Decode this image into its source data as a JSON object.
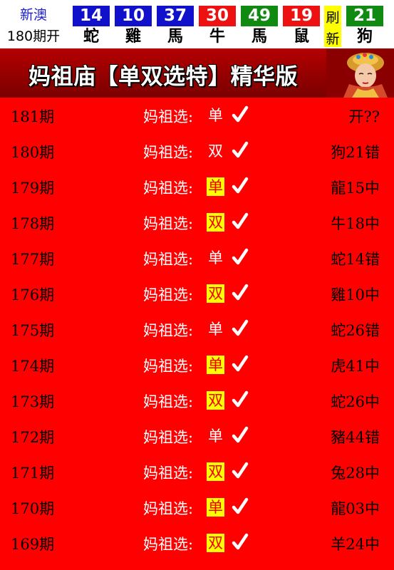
{
  "header": {
    "line1": "新澳",
    "line2": "180期开",
    "balls": [
      {
        "number": "14",
        "zodiac": "蛇",
        "color": "blue"
      },
      {
        "number": "10",
        "zodiac": "雞",
        "color": "blue"
      },
      {
        "number": "37",
        "zodiac": "馬",
        "color": "blue"
      },
      {
        "number": "30",
        "zodiac": "牛",
        "color": "red"
      },
      {
        "number": "49",
        "zodiac": "馬",
        "color": "green"
      },
      {
        "number": "19",
        "zodiac": "鼠",
        "color": "red"
      },
      {
        "number": "21",
        "zodiac": "狗",
        "color": "green"
      }
    ],
    "refresh": {
      "top": "刷",
      "bottom": "新"
    }
  },
  "banner": {
    "title": "妈祖庙【单双选特】精华版"
  },
  "rows": [
    {
      "period": "181期",
      "label": "妈祖选:",
      "pick": "单",
      "highlight": false,
      "result": "开??"
    },
    {
      "period": "180期",
      "label": "妈祖选:",
      "pick": "双",
      "highlight": false,
      "result": "狗21错"
    },
    {
      "period": "179期",
      "label": "妈祖选:",
      "pick": "单",
      "highlight": true,
      "result": "龍15中"
    },
    {
      "period": "178期",
      "label": "妈祖选:",
      "pick": "双",
      "highlight": true,
      "result": "牛18中"
    },
    {
      "period": "177期",
      "label": "妈祖选:",
      "pick": "单",
      "highlight": false,
      "result": "蛇14错"
    },
    {
      "period": "176期",
      "label": "妈祖选:",
      "pick": "双",
      "highlight": true,
      "result": "雞10中"
    },
    {
      "period": "175期",
      "label": "妈祖选:",
      "pick": "单",
      "highlight": false,
      "result": "蛇26错"
    },
    {
      "period": "174期",
      "label": "妈祖选:",
      "pick": "单",
      "highlight": true,
      "result": "虎41中"
    },
    {
      "period": "173期",
      "label": "妈祖选:",
      "pick": "双",
      "highlight": true,
      "result": "蛇26中"
    },
    {
      "period": "172期",
      "label": "妈祖选:",
      "pick": "单",
      "highlight": false,
      "result": "豬44错"
    },
    {
      "period": "171期",
      "label": "妈祖选:",
      "pick": "双",
      "highlight": true,
      "result": "兔28中"
    },
    {
      "period": "170期",
      "label": "妈祖选:",
      "pick": "单",
      "highlight": true,
      "result": "龍03中"
    },
    {
      "period": "169期",
      "label": "妈祖选:",
      "pick": "双",
      "highlight": true,
      "result": "羊24中"
    }
  ]
}
